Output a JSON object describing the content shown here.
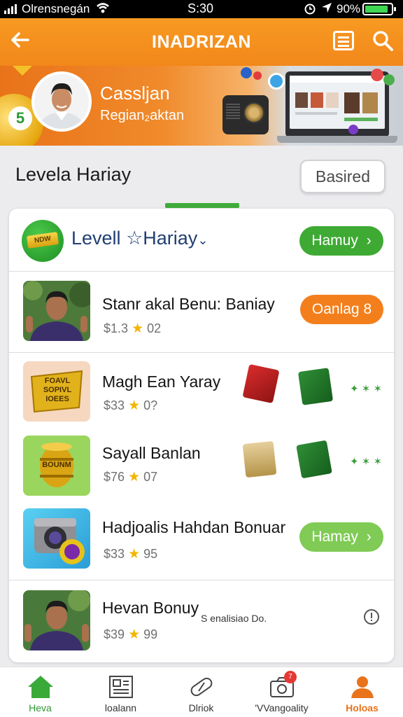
{
  "status_bar": {
    "carrier": "Olrensnegán",
    "time": "S:30",
    "battery_text": "90%",
    "battery_level": 0.9,
    "icons": [
      "signal-icon",
      "wifi-icon",
      "alarm-icon",
      "location-icon",
      "battery-icon"
    ]
  },
  "header": {
    "title": "INADRIZAN",
    "icons": [
      "back-arrow-icon",
      "menu-list-icon",
      "search-icon"
    ],
    "bg_color": "#f2871a"
  },
  "banner": {
    "name": "Casslјan",
    "region": "Regian₂aktan",
    "coin_mark": "5"
  },
  "section": {
    "title": "Levela Hariay",
    "button": "Basired"
  },
  "card": {
    "badge_text": "NDW",
    "title": "Levell",
    "title_star": "☆",
    "title_rest": "Hariay",
    "title_chevron": "⌄",
    "button": "Hamuy",
    "button_arrow": "›"
  },
  "rows": [
    {
      "title": "Stanr akal Benu: Baniay",
      "price": "$1.3",
      "rating": "02",
      "button": "Oanlag",
      "button_suffix": "8"
    },
    {
      "title": "Magh Ean Yaray",
      "price": "$33",
      "rating": "0?",
      "thumb_text": "FOAVL SOPIVL IOEES",
      "dots": "✦ ✶ ✶"
    },
    {
      "title": "Sayall Banlan",
      "price": "$76",
      "rating": "07",
      "thumb_text": "BOUNM",
      "dots": "✦ ✶ ✶"
    },
    {
      "title": "Hadjoalis Hahdan Bonuar",
      "price": "$33",
      "rating": "95",
      "button": "Hamay",
      "button_arrow": "›"
    },
    {
      "title": "Hevan Bonuy",
      "price": "$39",
      "rating": "99",
      "subtitle": "S enalisiao Do."
    }
  ],
  "rating_star": "★",
  "nav": [
    {
      "label": "Heva",
      "icon": "home-icon"
    },
    {
      "label": "loalann",
      "icon": "newspaper-icon"
    },
    {
      "label": "Dlriok",
      "icon": "pill-capsule-icon"
    },
    {
      "label": "'VVangoality",
      "icon": "camera-icon",
      "badge": "7"
    },
    {
      "label": "Holoas",
      "icon": "profile-icon"
    }
  ],
  "colors": {
    "orange": "#f2871a",
    "green": "#3eaa34",
    "light_green": "#7fcb55",
    "navy": "#213f74"
  }
}
